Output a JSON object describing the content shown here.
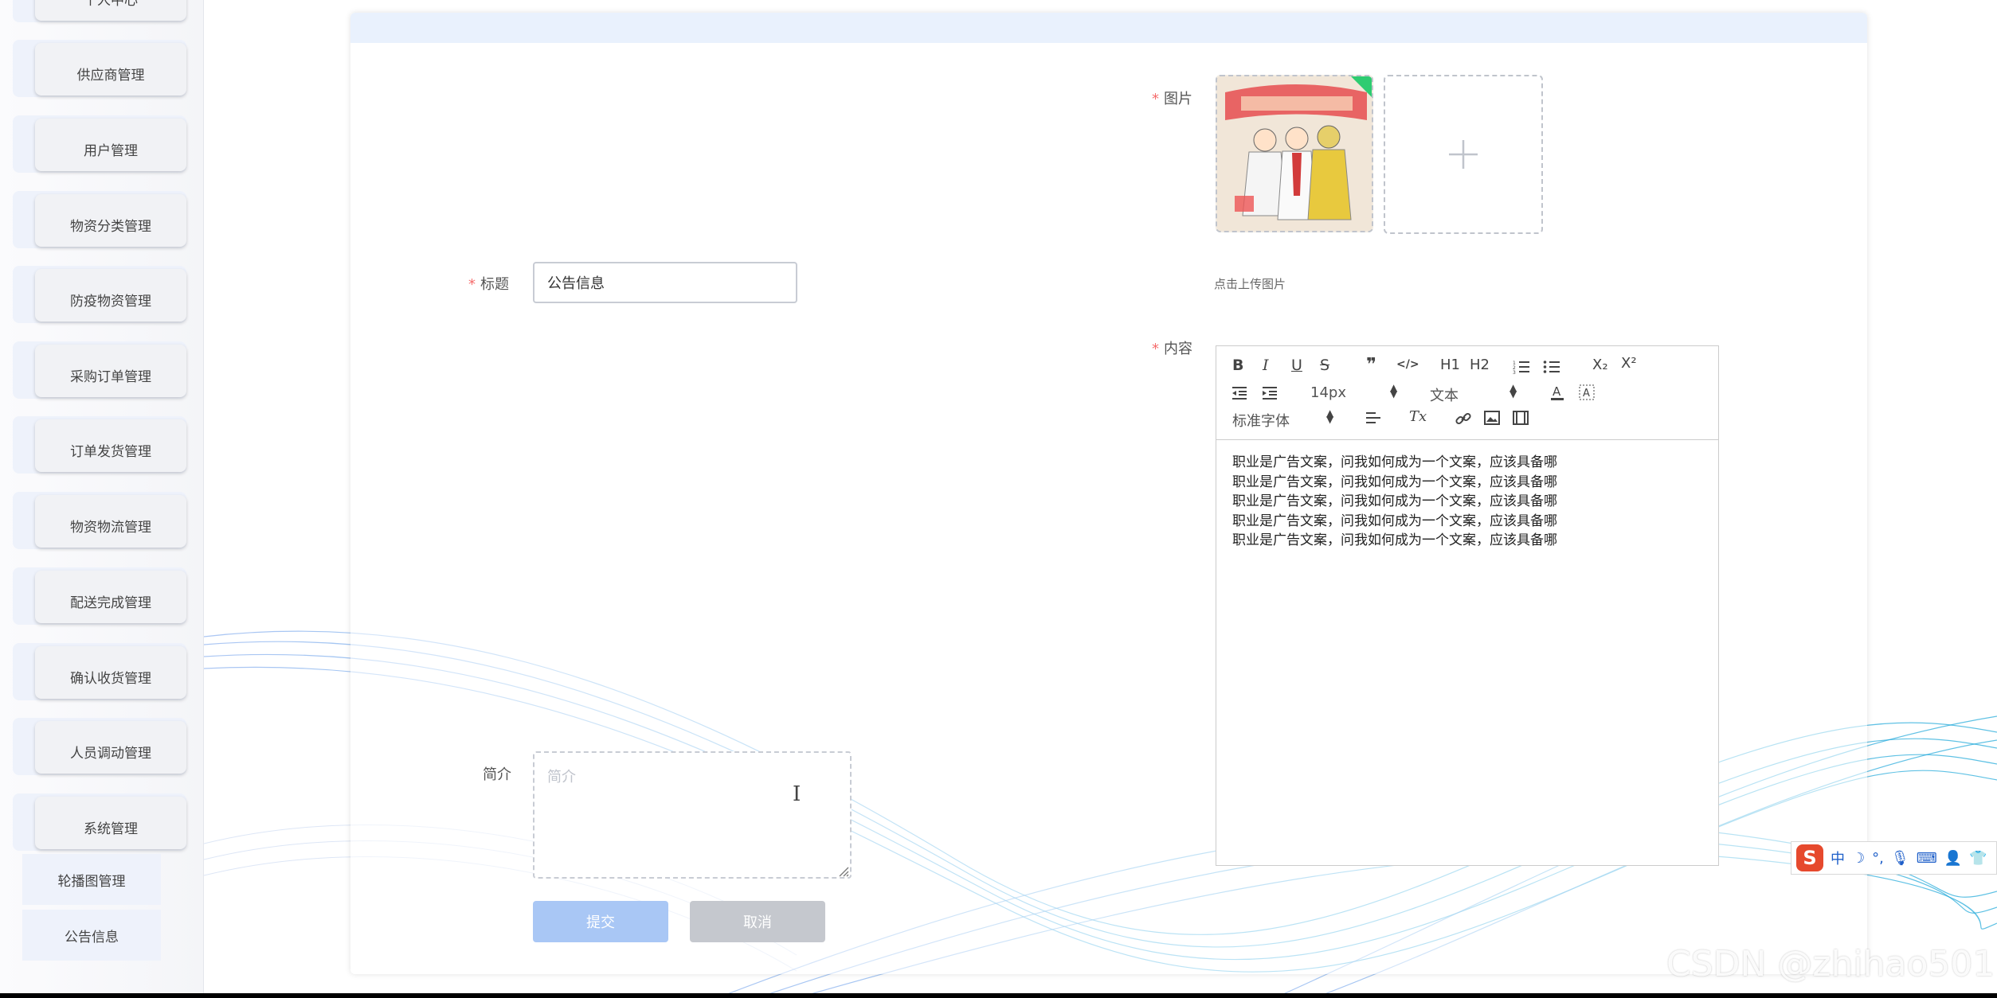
{
  "sidebar": {
    "top_partial_label": "个人中心",
    "items": [
      {
        "label": "供应商管理"
      },
      {
        "label": "用户管理"
      },
      {
        "label": "物资分类管理"
      },
      {
        "label": "防疫物资管理"
      },
      {
        "label": "采购订单管理"
      },
      {
        "label": "订单发货管理"
      },
      {
        "label": "物资物流管理"
      },
      {
        "label": "配送完成管理"
      },
      {
        "label": "确认收货管理"
      },
      {
        "label": "人员调动管理"
      },
      {
        "label": "系统管理"
      }
    ],
    "sub_items": [
      {
        "label": "轮播图管理"
      },
      {
        "label": "公告信息"
      }
    ]
  },
  "form": {
    "title_label": "标题",
    "title_value": "公告信息",
    "image_label": "图片",
    "upload_tip": "点击上传图片",
    "content_label": "内容",
    "intro_label": "简介",
    "intro_placeholder": "简介",
    "submit_label": "提交",
    "cancel_label": "取消",
    "required_mark": "*"
  },
  "editor": {
    "toolbar": {
      "bold": "B",
      "italic": "I",
      "underline": "U",
      "strike": "S",
      "quote": "❞",
      "code": "</>",
      "h1": "H1",
      "h2": "H2",
      "sub": "X₂",
      "sup": "X²",
      "font_size": "14px",
      "header_select": "文本",
      "font_family": "标准字体",
      "clear_format": "Tx"
    },
    "lines": [
      "职业是广告文案，问我如何成为一个文案，应该具备哪",
      "职业是广告文案，问我如何成为一个文案，应该具备哪",
      "职业是广告文案，问我如何成为一个文案，应该具备哪",
      "职业是广告文案，问我如何成为一个文案，应该具备哪",
      "职业是广告文案，问我如何成为一个文案，应该具备哪"
    ]
  },
  "ime": {
    "logo": "S",
    "mode": "中"
  },
  "watermark": "CSDN @zhihao501",
  "colors": {
    "accent": "#409eff",
    "required": "#f56c6c",
    "submit_bg": "#a9c7f5",
    "cancel_bg": "#c5c8ce"
  }
}
